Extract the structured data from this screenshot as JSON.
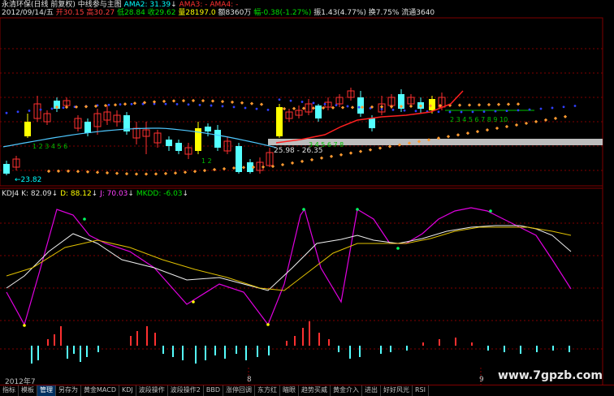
{
  "header": {
    "stock_name": "永清环保(日线 前复权)",
    "indicator": "中线参与主图",
    "ama2": "AMA2: 31.39",
    "ama3": "AMA3: -",
    "ama4": "AMA4: -",
    "arrow_down": "↓",
    "date": "2012/09/14/五",
    "open": "开30.15",
    "high": "高30.27",
    "low": "低28.84",
    "close": "收29.62",
    "volume": "量28197.0",
    "amount": "额8360万",
    "change": "幅-0.38(-1.27%)",
    "amplitude": "振1.43(4.77%)",
    "turnover": "换7.75%",
    "float": "流通3640"
  },
  "annotations": {
    "low_label": "←23.82",
    "range_label": "25.98 - 26.35",
    "counts_1": "1 2 3 4 5 6",
    "counts_2": "1 2",
    "counts_3": "3 4 5 6 7 8",
    "counts_4": "2 3 4 5 6 7 8 9 10"
  },
  "kdj": {
    "name": "KDJ4",
    "k": "K: 82.09",
    "d": "D: 88.12",
    "j": "J: 70.03",
    "mkdd": "MKDD: -6.03",
    "arrow": "↓"
  },
  "xaxis": {
    "labels": [
      "2012年7",
      "8",
      "9"
    ]
  },
  "tabs": [
    "指标",
    "模板",
    "管理",
    "另存为",
    "黄金MACD",
    "KDJ",
    "波段操作",
    "波段操作2",
    "BBD",
    "涨停回调",
    "东方红",
    "瞄眼",
    "趋势买威",
    "黄金介入",
    "进出",
    "好好风光",
    "RSI"
  ],
  "active_tab_index": 2,
  "watermark": "www.7gpzb.com",
  "colors": {
    "up": "#ff3c3c",
    "down": "#54ffff",
    "k_line": "#ffffff",
    "d_line": "#ffff00",
    "j_line": "#ff00ff"
  }
}
